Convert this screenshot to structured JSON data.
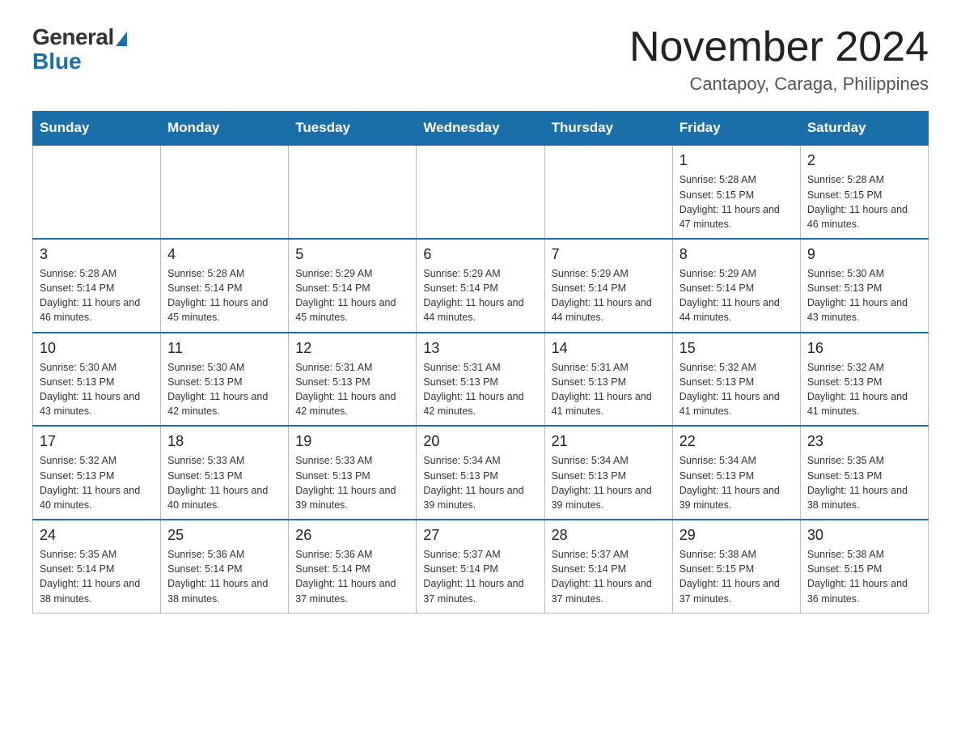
{
  "logo": {
    "general": "General",
    "blue": "Blue"
  },
  "header": {
    "month_title": "November 2024",
    "location": "Cantapoy, Caraga, Philippines"
  },
  "days_of_week": [
    "Sunday",
    "Monday",
    "Tuesday",
    "Wednesday",
    "Thursday",
    "Friday",
    "Saturday"
  ],
  "weeks": [
    [
      {
        "day": "",
        "info": ""
      },
      {
        "day": "",
        "info": ""
      },
      {
        "day": "",
        "info": ""
      },
      {
        "day": "",
        "info": ""
      },
      {
        "day": "",
        "info": ""
      },
      {
        "day": "1",
        "info": "Sunrise: 5:28 AM\nSunset: 5:15 PM\nDaylight: 11 hours and 47 minutes."
      },
      {
        "day": "2",
        "info": "Sunrise: 5:28 AM\nSunset: 5:15 PM\nDaylight: 11 hours and 46 minutes."
      }
    ],
    [
      {
        "day": "3",
        "info": "Sunrise: 5:28 AM\nSunset: 5:14 PM\nDaylight: 11 hours and 46 minutes."
      },
      {
        "day": "4",
        "info": "Sunrise: 5:28 AM\nSunset: 5:14 PM\nDaylight: 11 hours and 45 minutes."
      },
      {
        "day": "5",
        "info": "Sunrise: 5:29 AM\nSunset: 5:14 PM\nDaylight: 11 hours and 45 minutes."
      },
      {
        "day": "6",
        "info": "Sunrise: 5:29 AM\nSunset: 5:14 PM\nDaylight: 11 hours and 44 minutes."
      },
      {
        "day": "7",
        "info": "Sunrise: 5:29 AM\nSunset: 5:14 PM\nDaylight: 11 hours and 44 minutes."
      },
      {
        "day": "8",
        "info": "Sunrise: 5:29 AM\nSunset: 5:14 PM\nDaylight: 11 hours and 44 minutes."
      },
      {
        "day": "9",
        "info": "Sunrise: 5:30 AM\nSunset: 5:13 PM\nDaylight: 11 hours and 43 minutes."
      }
    ],
    [
      {
        "day": "10",
        "info": "Sunrise: 5:30 AM\nSunset: 5:13 PM\nDaylight: 11 hours and 43 minutes."
      },
      {
        "day": "11",
        "info": "Sunrise: 5:30 AM\nSunset: 5:13 PM\nDaylight: 11 hours and 42 minutes."
      },
      {
        "day": "12",
        "info": "Sunrise: 5:31 AM\nSunset: 5:13 PM\nDaylight: 11 hours and 42 minutes."
      },
      {
        "day": "13",
        "info": "Sunrise: 5:31 AM\nSunset: 5:13 PM\nDaylight: 11 hours and 42 minutes."
      },
      {
        "day": "14",
        "info": "Sunrise: 5:31 AM\nSunset: 5:13 PM\nDaylight: 11 hours and 41 minutes."
      },
      {
        "day": "15",
        "info": "Sunrise: 5:32 AM\nSunset: 5:13 PM\nDaylight: 11 hours and 41 minutes."
      },
      {
        "day": "16",
        "info": "Sunrise: 5:32 AM\nSunset: 5:13 PM\nDaylight: 11 hours and 41 minutes."
      }
    ],
    [
      {
        "day": "17",
        "info": "Sunrise: 5:32 AM\nSunset: 5:13 PM\nDaylight: 11 hours and 40 minutes."
      },
      {
        "day": "18",
        "info": "Sunrise: 5:33 AM\nSunset: 5:13 PM\nDaylight: 11 hours and 40 minutes."
      },
      {
        "day": "19",
        "info": "Sunrise: 5:33 AM\nSunset: 5:13 PM\nDaylight: 11 hours and 39 minutes."
      },
      {
        "day": "20",
        "info": "Sunrise: 5:34 AM\nSunset: 5:13 PM\nDaylight: 11 hours and 39 minutes."
      },
      {
        "day": "21",
        "info": "Sunrise: 5:34 AM\nSunset: 5:13 PM\nDaylight: 11 hours and 39 minutes."
      },
      {
        "day": "22",
        "info": "Sunrise: 5:34 AM\nSunset: 5:13 PM\nDaylight: 11 hours and 39 minutes."
      },
      {
        "day": "23",
        "info": "Sunrise: 5:35 AM\nSunset: 5:13 PM\nDaylight: 11 hours and 38 minutes."
      }
    ],
    [
      {
        "day": "24",
        "info": "Sunrise: 5:35 AM\nSunset: 5:14 PM\nDaylight: 11 hours and 38 minutes."
      },
      {
        "day": "25",
        "info": "Sunrise: 5:36 AM\nSunset: 5:14 PM\nDaylight: 11 hours and 38 minutes."
      },
      {
        "day": "26",
        "info": "Sunrise: 5:36 AM\nSunset: 5:14 PM\nDaylight: 11 hours and 37 minutes."
      },
      {
        "day": "27",
        "info": "Sunrise: 5:37 AM\nSunset: 5:14 PM\nDaylight: 11 hours and 37 minutes."
      },
      {
        "day": "28",
        "info": "Sunrise: 5:37 AM\nSunset: 5:14 PM\nDaylight: 11 hours and 37 minutes."
      },
      {
        "day": "29",
        "info": "Sunrise: 5:38 AM\nSunset: 5:15 PM\nDaylight: 11 hours and 37 minutes."
      },
      {
        "day": "30",
        "info": "Sunrise: 5:38 AM\nSunset: 5:15 PM\nDaylight: 11 hours and 36 minutes."
      }
    ]
  ]
}
